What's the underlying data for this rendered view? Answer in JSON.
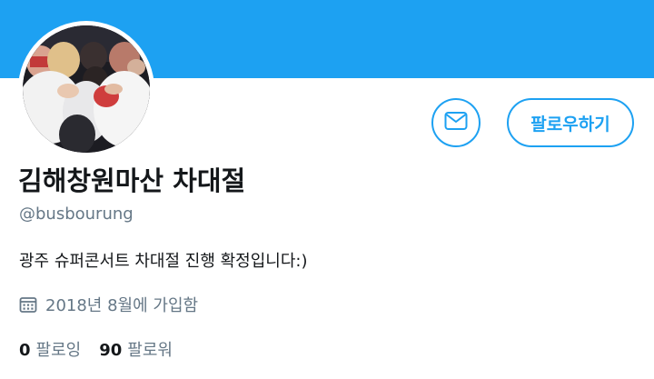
{
  "profile": {
    "display_name": "김해창원마산 차대절",
    "handle": "@busbourung",
    "bio": "광주 슈퍼콘서트 차대절 진행 확정입니다:)",
    "joined": "2018년 8월에 가입함",
    "following_count": "0",
    "following_label": "팔로잉",
    "followers_count": "90",
    "followers_label": "팔로워"
  },
  "actions": {
    "follow_label": "팔로우하기",
    "message_icon": "envelope-icon"
  },
  "colors": {
    "accent": "#1da1f2",
    "banner": "#1da1f2",
    "secondary_text": "#657786",
    "primary_text": "#14171a"
  },
  "icons": {
    "joined": "calendar-icon"
  }
}
